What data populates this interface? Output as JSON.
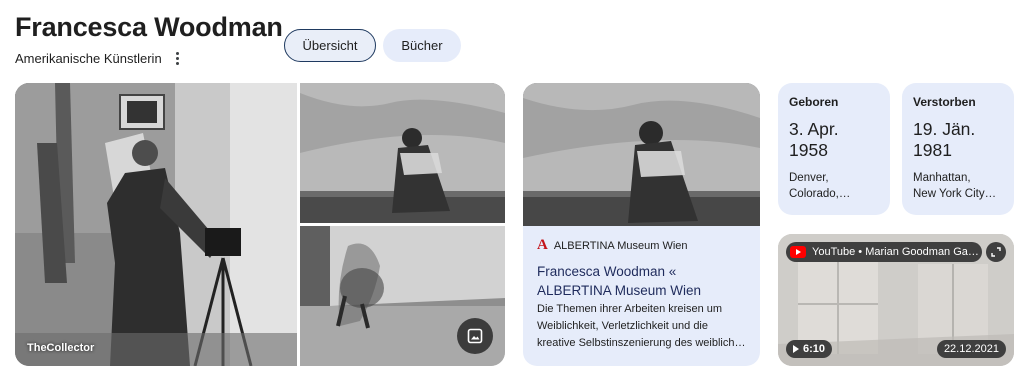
{
  "header": {
    "title": "Francesca Woodman",
    "subtitle": "Amerikanische Künstlerin",
    "more_icon": "more-vert-icon"
  },
  "tabs": [
    {
      "label": "Übersicht",
      "active": true
    },
    {
      "label": "Bücher",
      "active": false
    }
  ],
  "images": {
    "main_source": "TheCollector",
    "image_search_icon": "image-icon"
  },
  "article": {
    "source": "ALBERTINA Museum Wien",
    "source_icon": "albertina-logo",
    "title": "Francesca Woodman « ALBERTINA Museum Wien",
    "description_lines": [
      "Die Themen ihrer Arbeiten kreisen um",
      "Weiblichkeit, Verletzlichkeit und die",
      "kreative Selbstinszenierung des weiblich…"
    ]
  },
  "facts": {
    "born": {
      "label": "Geboren",
      "date_lines": [
        "3. Apr.",
        "1958"
      ],
      "place_lines": [
        "Denver,",
        "Colorado,…"
      ]
    },
    "died": {
      "label": "Verstorben",
      "date_lines": [
        "19. Jän.",
        "1981"
      ],
      "place_lines": [
        "Manhattan,",
        "New York City…"
      ]
    }
  },
  "video": {
    "channel": "YouTube • Marian Goodman Ga…",
    "duration": "6:10",
    "date": "22.12.2021"
  },
  "colors": {
    "card_bg": "#e6ecfa",
    "active_chip_border": "#1f3a60",
    "link_title": "#1f2b5c",
    "albertina_red": "#c4141b",
    "youtube_red": "#ff0000"
  }
}
